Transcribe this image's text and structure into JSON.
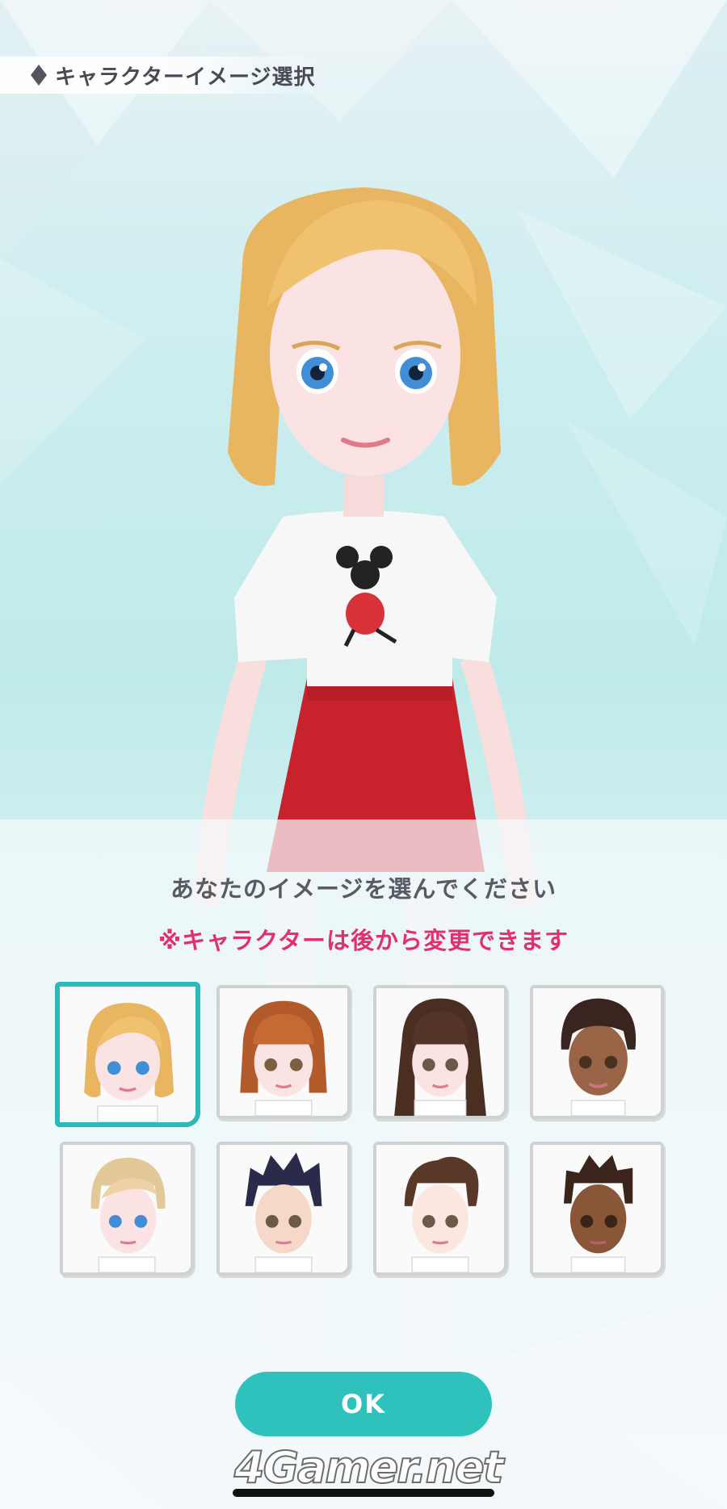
{
  "header": {
    "title": "キャラクターイメージ選択",
    "icon": "diamond-icon"
  },
  "panel": {
    "prompt": "あなたのイメージを選んでください",
    "notice": "※キャラクターは後から変更できます"
  },
  "characters": [
    {
      "id": "1",
      "hair": "blonde-bob",
      "skin": "light",
      "selected": true
    },
    {
      "id": "2",
      "hair": "auburn-bob",
      "skin": "light",
      "selected": false
    },
    {
      "id": "3",
      "hair": "long-brown",
      "skin": "light",
      "selected": false
    },
    {
      "id": "4",
      "hair": "short-dark",
      "skin": "brown",
      "selected": false
    },
    {
      "id": "5",
      "hair": "blonde-short",
      "skin": "light",
      "selected": false
    },
    {
      "id": "6",
      "hair": "navy-spiky",
      "skin": "light",
      "selected": false
    },
    {
      "id": "7",
      "hair": "brown-quiff",
      "skin": "light",
      "selected": false
    },
    {
      "id": "8",
      "hair": "dark-spiky",
      "skin": "brown",
      "selected": false
    }
  ],
  "ok_button": {
    "label": "OK"
  },
  "watermark": "4Gamer.net",
  "colors": {
    "accent": "#2fc2bc",
    "notice": "#e0306e",
    "text": "#5a5a63"
  }
}
